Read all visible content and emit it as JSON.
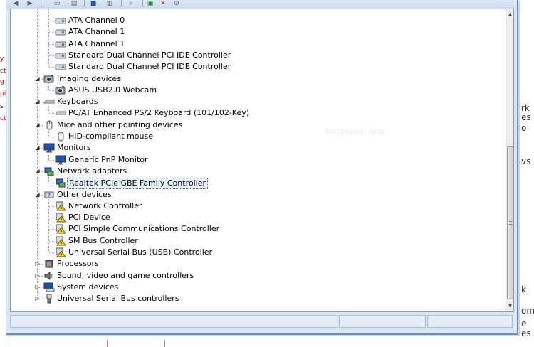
{
  "tree": {
    "items": [
      {
        "label": "ATA Channel 0",
        "level": 2,
        "icon": "ide-channel-icon"
      },
      {
        "label": "ATA Channel 1",
        "level": 2,
        "icon": "ide-channel-icon"
      },
      {
        "label": "ATA Channel 1",
        "level": 2,
        "icon": "ide-channel-icon"
      },
      {
        "label": "Standard Dual Channel PCI IDE Controller",
        "level": 2,
        "icon": "ide-channel-icon"
      },
      {
        "label": "Standard Dual Channel PCI IDE Controller",
        "level": 2,
        "icon": "ide-channel-icon"
      },
      {
        "label": "Imaging devices",
        "level": 1,
        "expanded": true,
        "icon": "camera-icon"
      },
      {
        "label": "ASUS USB2.0 Webcam",
        "level": 2,
        "icon": "camera-icon"
      },
      {
        "label": "Keyboards",
        "level": 1,
        "expanded": true,
        "icon": "keyboard-icon"
      },
      {
        "label": "PC/AT Enhanced PS/2 Keyboard (101/102-Key)",
        "level": 2,
        "icon": "keyboard-icon"
      },
      {
        "label": "Mice and other pointing devices",
        "level": 1,
        "expanded": true,
        "icon": "mouse-icon"
      },
      {
        "label": "HID-compliant mouse",
        "level": 2,
        "icon": "mouse-icon"
      },
      {
        "label": "Monitors",
        "level": 1,
        "expanded": true,
        "icon": "monitor-icon"
      },
      {
        "label": "Generic PnP Monitor",
        "level": 2,
        "icon": "monitor-icon"
      },
      {
        "label": "Network adapters",
        "level": 1,
        "expanded": true,
        "icon": "network-adapter-icon"
      },
      {
        "label": "Realtek PCIe GBE Family Controller",
        "level": 2,
        "icon": "network-adapter-icon",
        "selected": true
      },
      {
        "label": "Other devices",
        "level": 1,
        "expanded": true,
        "icon": "unknown-device-icon"
      },
      {
        "label": "Network Controller",
        "level": 2,
        "icon": "warning-device-icon"
      },
      {
        "label": "PCI Device",
        "level": 2,
        "icon": "warning-device-icon"
      },
      {
        "label": "PCI Simple Communications Controller",
        "level": 2,
        "icon": "warning-device-icon"
      },
      {
        "label": "SM Bus Controller",
        "level": 2,
        "icon": "warning-device-icon"
      },
      {
        "label": "Universal Serial Bus (USB) Controller",
        "level": 2,
        "icon": "warning-device-icon"
      },
      {
        "label": "Processors",
        "level": 1,
        "expanded": false,
        "icon": "processor-icon"
      },
      {
        "label": "Sound, video and game controllers",
        "level": 1,
        "expanded": false,
        "icon": "speaker-icon"
      },
      {
        "label": "System devices",
        "level": 1,
        "expanded": false,
        "icon": "system-device-icon"
      },
      {
        "label": "Universal Serial Bus controllers",
        "level": 1,
        "expanded": false,
        "icon": "usb-icon"
      }
    ]
  },
  "background": {
    "ghost_text": "Rectangular Snip",
    "right_fragments": [
      "rk",
      "es",
      "o",
      "vs",
      "k",
      "om",
      "e",
      "es"
    ],
    "left_fragments": [
      "y",
      "ct",
      "g",
      "pi",
      "s",
      "ct"
    ]
  },
  "toolbar": {
    "icons": [
      "back-icon",
      "forward-icon",
      "properties-icon",
      "help-icon",
      "show-hidden-icon",
      "scan-hardware-icon",
      "update-driver-icon",
      "uninstall-icon",
      "disable-icon"
    ]
  },
  "colors": {
    "window_border": "#6c8fbf",
    "tree_border": "#7f9db9",
    "selection_bg": "#eaf1fb"
  }
}
